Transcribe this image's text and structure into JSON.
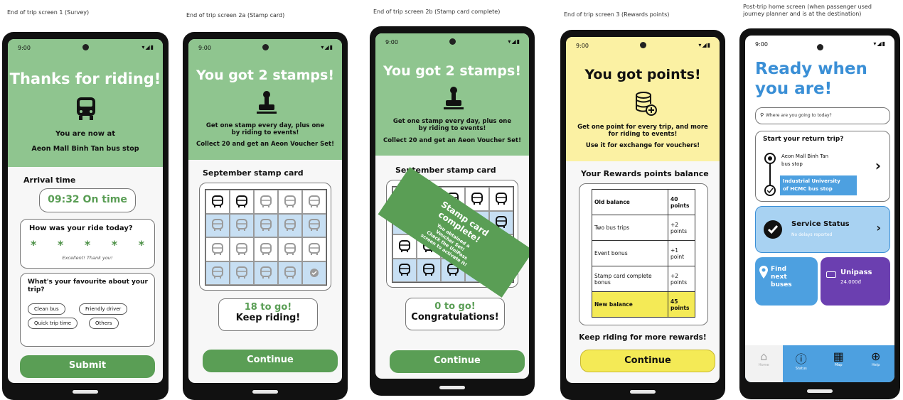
{
  "captions": {
    "s1": "End of trip screen 1 (Survey)",
    "s2a": "End of trip screen 2a (Stamp card)",
    "s2b": "End of trip screen 2b (Stamp card complete)",
    "s3": "End of trip screen 3 (Rewards points)",
    "home_l1": "Post-trip home screen (when passenger used",
    "home_l2": "journey planner and is at the destination)"
  },
  "status": {
    "time": "9:00"
  },
  "survey": {
    "title": "Thanks for riding!",
    "location_line1": "You are now at",
    "location_line2": "Aeon Mall Binh Tan bus stop",
    "arrival_label": "Arrival time",
    "arrival_value": "09:32 On time",
    "ride_question": "How was your ride today?",
    "stars": [
      "*",
      "*",
      "*",
      "*",
      "*"
    ],
    "rating_text": "Excellent! Thank you!",
    "favourite_question": "What's your favourite about your trip?",
    "tags": [
      "Clean bus",
      "Friendly driver",
      "Quick trip time",
      "Others"
    ],
    "submit": "Submit"
  },
  "stamp": {
    "title": "You got 2 stamps!",
    "line1": "Get one stamp every day, plus one by riding to events!",
    "line2": "Collect 20 and get an Aeon Voucher Set!",
    "card_title": "September stamp card",
    "progress": "18 to go!",
    "keep": "Keep riding!",
    "continue": "Continue",
    "stamps_filled": 2,
    "stamps_total": 20
  },
  "complete": {
    "title": "You got 2 stamps!",
    "line1": "Get one stamp every day, plus one by riding to events!",
    "line2": "Collect 20 and get an Aeon Voucher Set!",
    "card_title": "September stamp card",
    "banner_title1": "Stamp card",
    "banner_title2": "complete!",
    "banner_text1": "You obtained a",
    "banner_text2": "Voucher Set!",
    "banner_text3": "Check the UniPass",
    "banner_text4": "screen to activate it!",
    "progress": "0 to go!",
    "congrats": "Congratulations!",
    "continue": "Continue"
  },
  "points": {
    "title": "You got points!",
    "line1": "Get one point for every trip, and more for riding to events!",
    "line2": "Use it for exchange for vouchers!",
    "balance_title": "Your Rewards points balance",
    "rows": [
      {
        "label": "Old balance",
        "value": "40 points",
        "highlight": false,
        "bold": true
      },
      {
        "label": "Two bus trips",
        "value": "+2 points",
        "highlight": false,
        "bold": false
      },
      {
        "label": "Event bonus",
        "value": "+1 point",
        "highlight": false,
        "bold": false
      },
      {
        "label": "Stamp card complete bonus",
        "value": "+2 points",
        "highlight": false,
        "bold": false
      },
      {
        "label": "New balance",
        "value": "45 points",
        "highlight": true,
        "bold": true
      }
    ],
    "keep": "Keep riding for more rewards!",
    "continue": "Continue"
  },
  "home": {
    "title1": "Ready when",
    "title2": "you are!",
    "search_placeholder": "Where are you going to today?",
    "return_title": "Start your return trip?",
    "from_line1": "Aeon Mall Binh Tan",
    "from_line2": "bus stop",
    "to_line1": "Industrial University",
    "to_line2": "of HCMC bus stop",
    "service_title": "Service Status",
    "service_sub": "No delays reported",
    "find1": "Find",
    "find2": "next",
    "find3": "buses",
    "unipass_title": "Unipass",
    "unipass_amount": "24.000đ",
    "nav": [
      "Home",
      "Status",
      "Map",
      "Help"
    ]
  },
  "colors": {
    "green_header": "#8fc58f",
    "green_button": "#5a9e55",
    "yellow_header": "#fbf1a3",
    "yellow_button": "#f4ea56",
    "blue": "#4da0e0",
    "purple": "#6b3fb0",
    "stamp_blue": "#c7dff3"
  }
}
